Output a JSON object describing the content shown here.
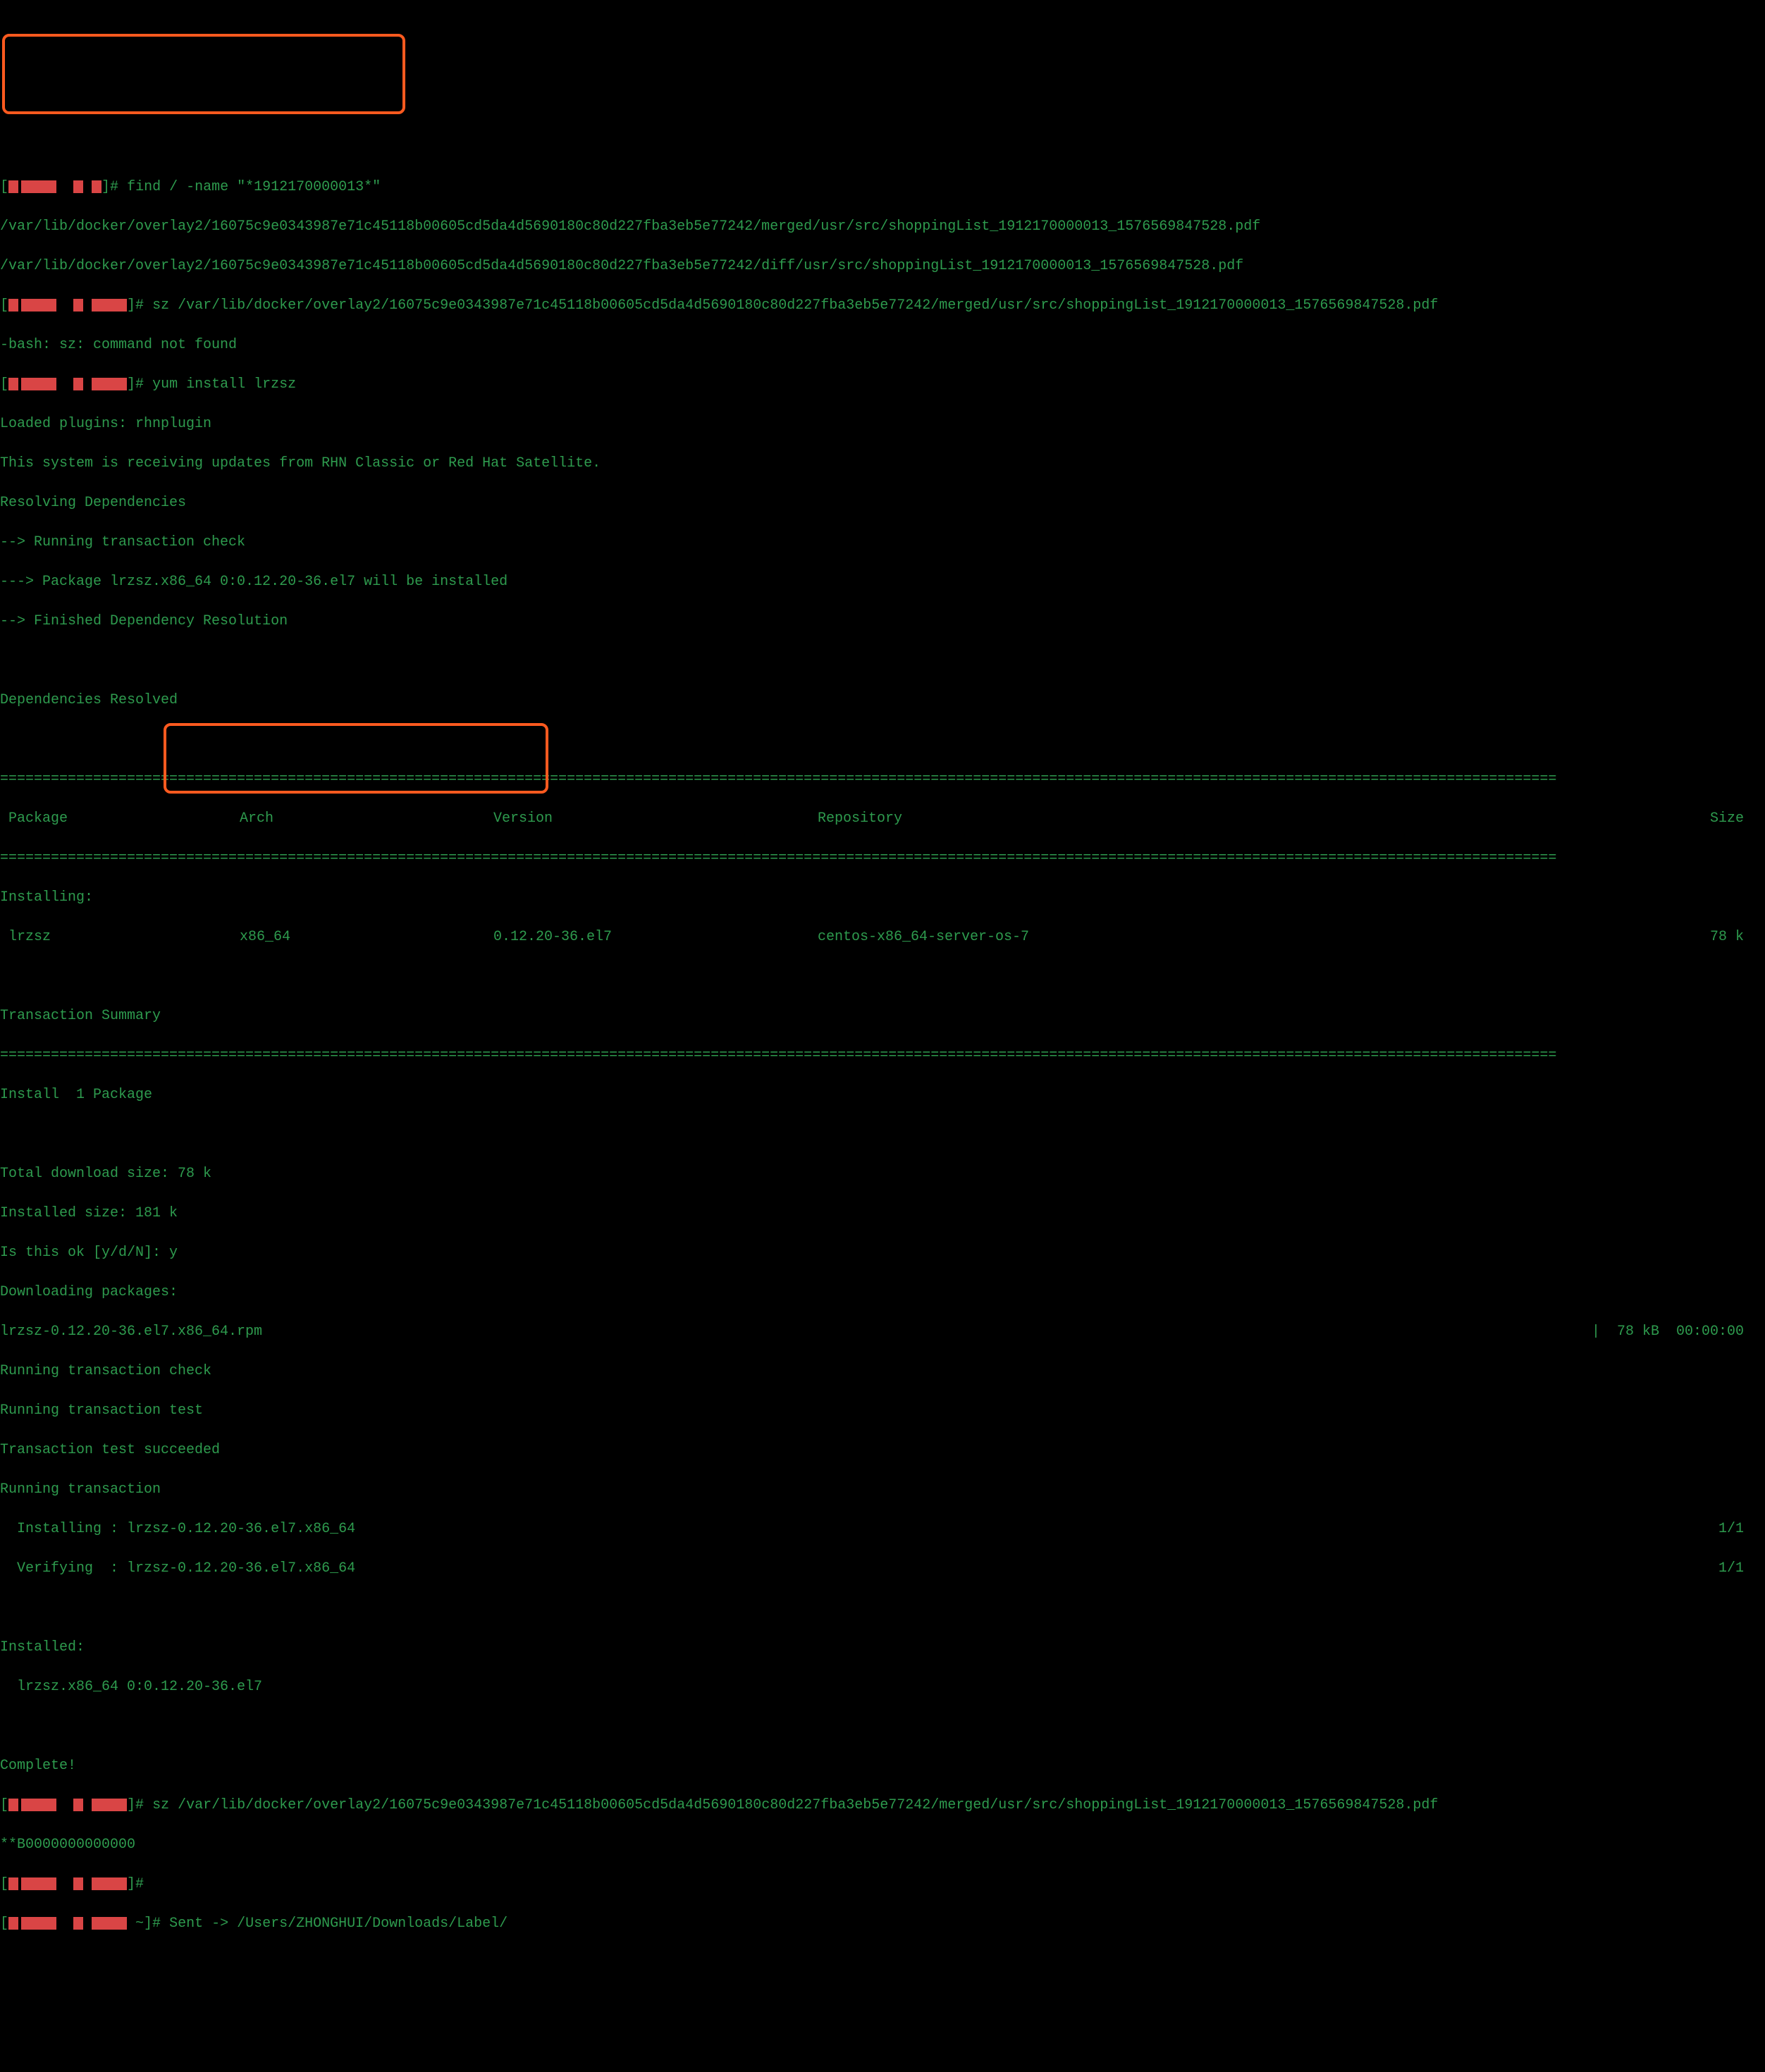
{
  "prompt_suffix": "]# ",
  "cmd_find": "find / -name \"*1912170000013*\"",
  "find_result1": "/var/lib/docker/overlay2/16075c9e0343987e71c45118b00605cd5da4d5690180c80d227fba3eb5e77242/merged/usr/src/shoppingList_1912170000013_1576569847528.pdf",
  "find_result2": "/var/lib/docker/overlay2/16075c9e0343987e71c45118b00605cd5da4d5690180c80d227fba3eb5e77242/diff/usr/src/shoppingList_1912170000013_1576569847528.pdf",
  "cmd_sz": "sz /var/lib/docker/overlay2/16075c9e0343987e71c45118b00605cd5da4d5690180c80d227fba3eb5e77242/merged/usr/src/shoppingList_1912170000013_1576569847528.pdf",
  "err_bash": "-bash: sz: command not found",
  "cmd_yum": "yum install lrzsz",
  "yum_plugins": "Loaded plugins: rhnplugin",
  "yum_rhn": "This system is receiving updates from RHN Classic or Red Hat Satellite.",
  "yum_resolving": "Resolving Dependencies",
  "yum_check": "--> Running transaction check",
  "yum_pkg_install": "---> Package lrzsz.x86_64 0:0.12.20-36.el7 will be installed",
  "yum_finished": "--> Finished Dependency Resolution",
  "yum_deps_resolved": "Dependencies Resolved",
  "table_divider": "========================================================================================================================================================================================",
  "table_header": {
    "package": " Package",
    "arch": "Arch",
    "version": "Version",
    "repository": "Repository",
    "size": "Size"
  },
  "table_installing": "Installing:",
  "table_row": {
    "package": " lrzsz",
    "arch": "x86_64",
    "version": "0.12.20-36.el7",
    "repository": "centos-x86_64-server-os-7",
    "size": "78 k"
  },
  "txn_summary": "Transaction Summary",
  "install_count": "Install  1 Package",
  "total_dl": "Total download size: 78 k",
  "installed_size": "Installed size: 181 k",
  "is_ok": "Is this ok [y/d/N]: y",
  "downloading": "Downloading packages:",
  "dl_rpm": "lrzsz-0.12.20-36.el7.x86_64.rpm",
  "dl_progress": "|  78 kB  00:00:00",
  "run_check": "Running transaction check",
  "run_test": "Running transaction test",
  "txn_succeeded": "Transaction test succeeded",
  "run_txn": "Running transaction",
  "installing_pkg": "  Installing : lrzsz-0.12.20-36.el7.x86_64",
  "verifying_pkg": "  Verifying  : lrzsz-0.12.20-36.el7.x86_64",
  "progress_1_1": "1/1",
  "installed_hdr": "Installed:",
  "installed_pkg": "  lrzsz.x86_64 0:0.12.20-36.el7",
  "complete": "Complete!",
  "cmd_sz2_prefix": "]# ",
  "cmd_sz2": "sz /var/lib/docker/overlay2/16075c9e0343987e71c45118b00605cd5da4d5690180c80d227fba3eb5e77242/merged/usr/src/shoppingList_1912170000013_1576569847528.pdf",
  "b_zeros": "**B0000000000000",
  "prompt_empty": "]# ",
  "prompt_last_prefix": " ~]# ",
  "sent_line": "Sent -> /Users/ZHONGHUI/Downloads/Label/"
}
